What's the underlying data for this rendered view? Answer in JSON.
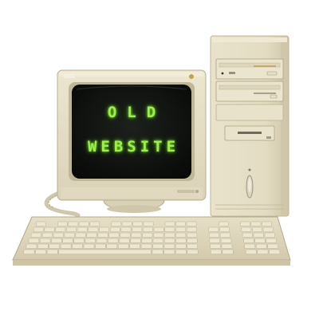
{
  "screen": {
    "line1": "OLD",
    "line2": "WEBSITE",
    "text_color": "#9cf04a"
  },
  "colors": {
    "background": "#ffffff",
    "beige_case": "#e7e1cb",
    "beige_shadow": "#cfc7ab",
    "screen_dark": "#141614"
  }
}
